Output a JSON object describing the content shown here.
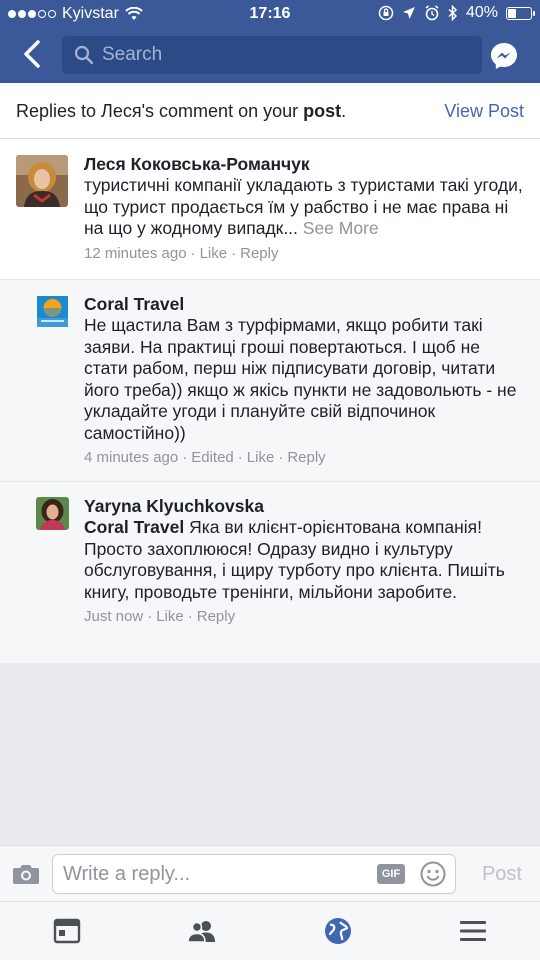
{
  "status_bar": {
    "carrier": "Kyivstar",
    "time": "17:16",
    "battery": "40%",
    "battery_level": 0.4
  },
  "nav": {
    "search_placeholder": "Search",
    "icons": [
      "back-chevron-icon",
      "search-icon",
      "messenger-icon"
    ]
  },
  "header": {
    "title_prefix": "Replies to Леся's comment on your ",
    "title_bold": "post",
    "title_suffix": ".",
    "view_post": "View Post"
  },
  "comments": [
    {
      "author": "Леся Коковська-Романчук",
      "text": "туристичні компанії укладають з туристами такі угоди, що турист продається їм у рабство і не має права ні на що у жодному випадк...",
      "see_more": " See More",
      "time": "12 minutes ago",
      "like": "Like",
      "reply": "Reply"
    },
    {
      "author": "Coral Travel",
      "text": "Не щастила Вам з турфірмами, якщо робити такі заяви. На практиці гроші повертаються. І щоб не стати рабом, перш ніж підписувати договір, читати його треба)) якщо ж якісь пункти не задовольють - не укладайте угоди і плануйте свій відпочинок самостійно))",
      "time": "4 minutes ago",
      "edited": "Edited",
      "like": "Like",
      "reply": "Reply"
    },
    {
      "author": "Yaryna Klyuchkovska",
      "tag": "Coral Travel",
      "text": " Яка ви клієнт-орієнтована компанія! Просто захоплююся! Одразу видно і культуру обслуговування, і щиру турботу про клієнта. Пишіть книгу, проводьте тренінги, мільйони заробите.",
      "time": "Just now",
      "like": "Like",
      "reply": "Reply"
    }
  ],
  "composer": {
    "placeholder": "Write a reply...",
    "gif": "GIF",
    "post": "Post"
  },
  "tabbar": {
    "icons": [
      "news-feed-icon",
      "friends-icon",
      "globe-icon",
      "menu-icon"
    ]
  },
  "colors": {
    "brand": "#3b5998",
    "link": "#4267b2",
    "meta": "#90949c"
  }
}
